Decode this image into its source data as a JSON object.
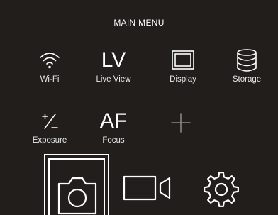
{
  "menu": {
    "title": "MAIN MENU"
  },
  "items": [
    {
      "label": "Wi-Fi",
      "icon": "wifi-icon"
    },
    {
      "label": "Live View",
      "glyph": "LV"
    },
    {
      "label": "Display",
      "icon": "display-icon"
    },
    {
      "label": "Storage",
      "icon": "storage-icon"
    },
    {
      "label": "Exposure",
      "icon": "exposure-icon"
    },
    {
      "label": "Focus",
      "glyph": "AF"
    }
  ],
  "add_item": {
    "icon": "plus-icon"
  },
  "modes": [
    {
      "name": "photo",
      "icon": "camera-icon",
      "selected": true
    },
    {
      "name": "video",
      "icon": "video-camera-icon",
      "selected": false
    },
    {
      "name": "settings",
      "icon": "gear-icon",
      "selected": false
    }
  ],
  "colors": {
    "background": "#211e1b",
    "foreground": "#ffffff",
    "muted": "#8a8784"
  }
}
